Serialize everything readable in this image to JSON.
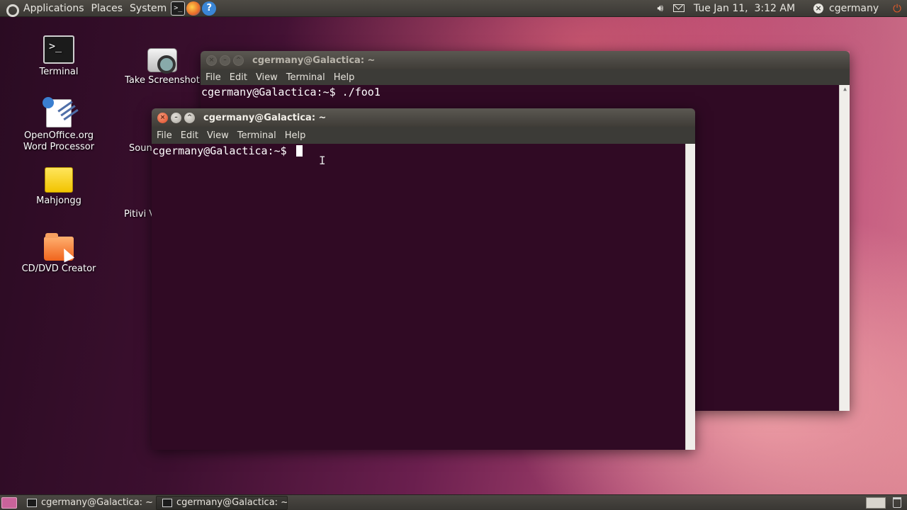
{
  "top_panel": {
    "menus": [
      "Applications",
      "Places",
      "System"
    ],
    "launchers": [
      "terminal-icon",
      "firefox-icon",
      "help-icon"
    ],
    "datetime": "Tue Jan 11,  3:12 AM",
    "username": "cgermany"
  },
  "desktop_icons": [
    {
      "label": "Terminal",
      "icon": "terminal-icon"
    },
    {
      "label": "Take Screenshot",
      "icon": "camera-icon"
    },
    {
      "label": "OpenOffice.org Word Processor",
      "icon": "word-processor-icon"
    },
    {
      "label": "Mahjongg",
      "icon": "mahjongg-icon"
    },
    {
      "label": "CD/DVD Creator",
      "icon": "cd-creator-folder-icon"
    }
  ],
  "partial_icons": [
    "Soun",
    "Pitivi V"
  ],
  "windows": [
    {
      "title": "cgermany@Galactica: ~",
      "state": "inactive",
      "menu": [
        "File",
        "Edit",
        "View",
        "Terminal",
        "Help"
      ],
      "lines": [
        "cgermany@Galactica:~$ ./foo1"
      ]
    },
    {
      "title": "cgermany@Galactica: ~",
      "state": "active",
      "menu": [
        "File",
        "Edit",
        "View",
        "Terminal",
        "Help"
      ],
      "lines": [
        "cgermany@Galactica:~$ "
      ]
    }
  ],
  "taskbar": [
    {
      "label": "cgermany@Galactica: ~",
      "active": false
    },
    {
      "label": "cgermany@Galactica: ~",
      "active": true
    }
  ],
  "colors": {
    "terminal_bg": "#300a24",
    "panel_bg": "#3c3b37",
    "close_button": "#df4a26"
  }
}
